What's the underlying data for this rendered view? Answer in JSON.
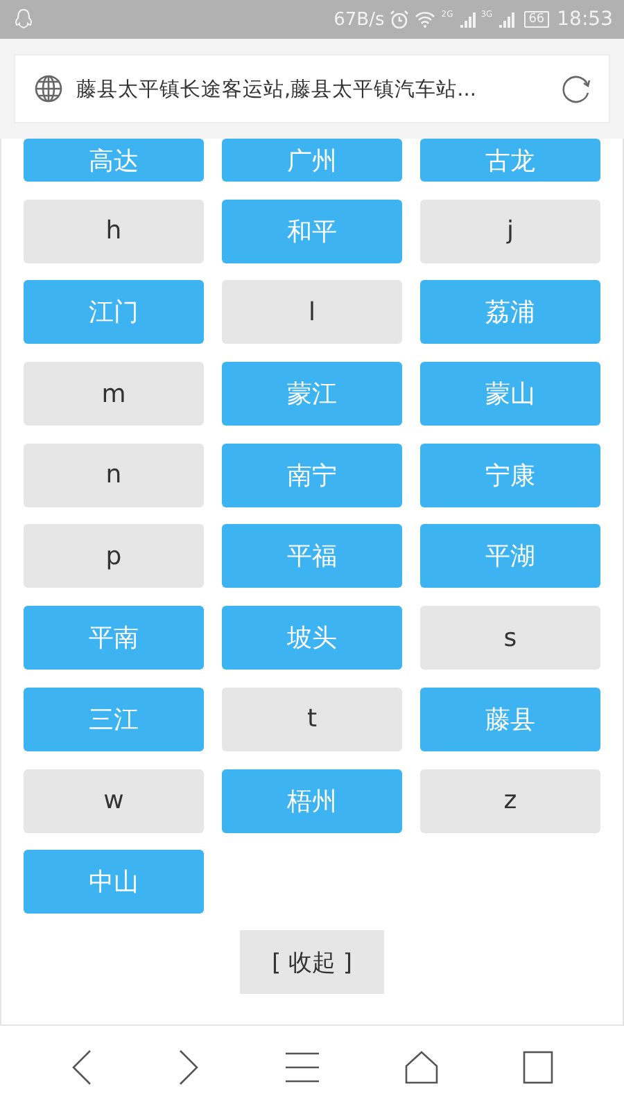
{
  "status_bar": {
    "speed": "67B/s",
    "signal_1": "2G",
    "signal_2": "3G",
    "battery": "66",
    "time": "18:53"
  },
  "address_bar": {
    "title": "藤县太平镇长途客运站,藤县太平镇汽车站..."
  },
  "buttons": [
    {
      "label": "高达",
      "kind": "city"
    },
    {
      "label": "广州",
      "kind": "city"
    },
    {
      "label": "古龙",
      "kind": "city"
    },
    {
      "label": "h",
      "kind": "letter"
    },
    {
      "label": "和平",
      "kind": "city"
    },
    {
      "label": "j",
      "kind": "letter"
    },
    {
      "label": "江门",
      "kind": "city"
    },
    {
      "label": "l",
      "kind": "letter"
    },
    {
      "label": "荔浦",
      "kind": "city"
    },
    {
      "label": "m",
      "kind": "letter"
    },
    {
      "label": "蒙江",
      "kind": "city"
    },
    {
      "label": "蒙山",
      "kind": "city"
    },
    {
      "label": "n",
      "kind": "letter"
    },
    {
      "label": "南宁",
      "kind": "city"
    },
    {
      "label": "宁康",
      "kind": "city"
    },
    {
      "label": "p",
      "kind": "letter"
    },
    {
      "label": "平福",
      "kind": "city"
    },
    {
      "label": "平湖",
      "kind": "city"
    },
    {
      "label": "平南",
      "kind": "city"
    },
    {
      "label": "坡头",
      "kind": "city"
    },
    {
      "label": "s",
      "kind": "letter"
    },
    {
      "label": "三江",
      "kind": "city"
    },
    {
      "label": "t",
      "kind": "letter"
    },
    {
      "label": "藤县",
      "kind": "city"
    },
    {
      "label": "w",
      "kind": "letter"
    },
    {
      "label": "梧州",
      "kind": "city"
    },
    {
      "label": "z",
      "kind": "letter"
    },
    {
      "label": "中山",
      "kind": "city"
    }
  ],
  "collapse_button": "[ 收起 ]"
}
